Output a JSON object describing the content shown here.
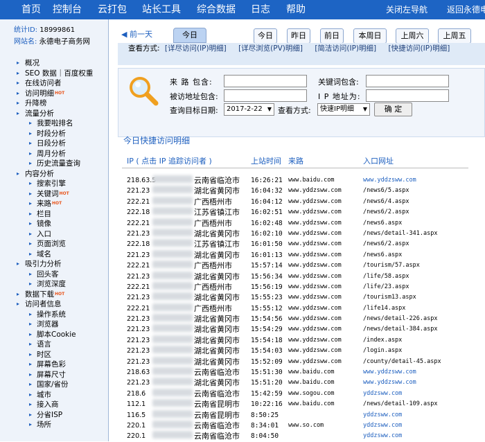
{
  "topnav": {
    "items": [
      "首页",
      "控制台",
      "云打包",
      "站长工具",
      "综合数据",
      "日志",
      "帮助"
    ],
    "close_sidebar": "关闭左导航",
    "back": "返回永德电"
  },
  "site": {
    "id_label": "统计ID:",
    "id_value": "18999861",
    "name_label": "网站名:",
    "name_value": "永德电子商务网"
  },
  "sidebar": {
    "items": [
      {
        "label": "概况",
        "level": 1,
        "hot": false
      },
      {
        "label": "SEO 数据｜百度权重",
        "level": 1,
        "hot": false
      },
      {
        "label": "在线访问者",
        "level": 1,
        "hot": false
      },
      {
        "label": "访问明细",
        "level": 1,
        "hot": true
      },
      {
        "label": "升降榜",
        "level": 1,
        "hot": false
      },
      {
        "label": "流量分析",
        "level": 1,
        "hot": false
      },
      {
        "label": "我要啦排名",
        "level": 2,
        "hot": false
      },
      {
        "label": "时段分析",
        "level": 2,
        "hot": false
      },
      {
        "label": "日段分析",
        "level": 2,
        "hot": false
      },
      {
        "label": "周月分析",
        "level": 2,
        "hot": false
      },
      {
        "label": "历史流量查询",
        "level": 2,
        "hot": false
      },
      {
        "label": "内容分析",
        "level": 1,
        "hot": false
      },
      {
        "label": "搜索引擎",
        "level": 2,
        "hot": false
      },
      {
        "label": "关键词",
        "level": 2,
        "hot": true
      },
      {
        "label": "来路",
        "level": 2,
        "hot": true
      },
      {
        "label": "栏目",
        "level": 2,
        "hot": false
      },
      {
        "label": "镜像",
        "level": 2,
        "hot": false
      },
      {
        "label": "入口",
        "level": 2,
        "hot": false
      },
      {
        "label": "页面浏览",
        "level": 2,
        "hot": false
      },
      {
        "label": "域名",
        "level": 2,
        "hot": false
      },
      {
        "label": "吸引力分析",
        "level": 1,
        "hot": false
      },
      {
        "label": "回头客",
        "level": 2,
        "hot": false
      },
      {
        "label": "浏览深度",
        "level": 2,
        "hot": false
      },
      {
        "label": "数据下载",
        "level": 1,
        "hot": true
      },
      {
        "label": "访问者信息",
        "level": 1,
        "hot": false
      },
      {
        "label": "操作系统",
        "level": 2,
        "hot": false
      },
      {
        "label": "浏览器",
        "level": 2,
        "hot": false
      },
      {
        "label": "脚本Cookie",
        "level": 2,
        "hot": false
      },
      {
        "label": "语言",
        "level": 2,
        "hot": false
      },
      {
        "label": "时区",
        "level": 2,
        "hot": false
      },
      {
        "label": "屏幕色彩",
        "level": 2,
        "hot": false
      },
      {
        "label": "屏幕尺寸",
        "level": 2,
        "hot": false
      },
      {
        "label": "国家/省份",
        "level": 2,
        "hot": false
      },
      {
        "label": "城市",
        "level": 2,
        "hot": false
      },
      {
        "label": "接入商",
        "level": 2,
        "hot": false
      },
      {
        "label": "分省ISP",
        "level": 2,
        "hot": false
      },
      {
        "label": "场所",
        "level": 2,
        "hot": false
      }
    ],
    "hot_text": "HOT"
  },
  "datebar": {
    "prev": "◀ 前一天",
    "today_tab": "今日",
    "buttons": [
      "今日",
      "昨日",
      "前日",
      "本周日",
      "上周六",
      "上周五"
    ]
  },
  "viewmode": {
    "label": "查看方式:",
    "links": [
      "[详尽访问(IP)明细]",
      "[详尽浏览(PV)明细]",
      "[简洁访问(IP)明细]",
      "[快捷访问(IP)明细]"
    ]
  },
  "filter": {
    "source_label": "来 路 包含:",
    "keyword_label": "关键词包含:",
    "page_label": "被访地址包含:",
    "ip_label": "I P 地址为:",
    "date_label": "查询目标日期:",
    "date_value": "2017-2-22",
    "view_label": "查看方式:",
    "view_value": "快速IP明细",
    "confirm": "确 定"
  },
  "list": {
    "title": "今日快捷访问明细",
    "headers": {
      "ip": "IP ( 点击 IP 追踪访问者 )",
      "time": "上站时间",
      "source": "来路",
      "entry": "入口网址"
    },
    "rows": [
      {
        "ip": "218.63.5",
        "loc": "云南省临沧市",
        "time": "16:26:21",
        "src": "www.baidu.com",
        "url": "www.yddzsww.com",
        "url_link": true
      },
      {
        "ip": "221.23",
        "loc": "湖北省黄冈市",
        "time": "16:04:32",
        "src": "www.yddzsww.com",
        "url": "/news6/5.aspx",
        "url_link": false
      },
      {
        "ip": "222.21",
        "loc": "广西梧州市",
        "time": "16:04:12",
        "src": "www.yddzsww.com",
        "url": "/news6/4.aspx",
        "url_link": false
      },
      {
        "ip": "222.18",
        "loc": "江苏省镇江市",
        "time": "16:02:51",
        "src": "www.yddzsww.com",
        "url": "/news6/2.aspx",
        "url_link": false
      },
      {
        "ip": "222.21",
        "loc": "广西梧州市",
        "time": "16:02:48",
        "src": "www.yddzsww.com",
        "url": "/news6.aspx",
        "url_link": false
      },
      {
        "ip": "221.23",
        "loc": "湖北省黄冈市",
        "time": "16:02:10",
        "src": "www.yddzsww.com",
        "url": "/news/detail-341.aspx",
        "url_link": false
      },
      {
        "ip": "222.18",
        "loc": "江苏省镇江市",
        "time": "16:01:50",
        "src": "www.yddzsww.com",
        "url": "/news6/2.aspx",
        "url_link": false
      },
      {
        "ip": "221.23",
        "loc": "湖北省黄冈市",
        "time": "16:01:13",
        "src": "www.yddzsww.com",
        "url": "/news6.aspx",
        "url_link": false
      },
      {
        "ip": "222.21",
        "loc": "广西梧州市",
        "time": "15:57:14",
        "src": "www.yddzsww.com",
        "url": "/tourism/57.aspx",
        "url_link": false
      },
      {
        "ip": "221.23",
        "loc": "湖北省黄冈市",
        "time": "15:56:34",
        "src": "www.yddzsww.com",
        "url": "/life/58.aspx",
        "url_link": false
      },
      {
        "ip": "222.21",
        "loc": "广西梧州市",
        "time": "15:56:19",
        "src": "www.yddzsww.com",
        "url": "/life/23.aspx",
        "url_link": false
      },
      {
        "ip": "221.23",
        "loc": "湖北省黄冈市",
        "time": "15:55:23",
        "src": "www.yddzsww.com",
        "url": "/tourism13.aspx",
        "url_link": false
      },
      {
        "ip": "222.21",
        "loc": "广西梧州市",
        "time": "15:55:12",
        "src": "www.yddzsww.com",
        "url": "/life14.aspx",
        "url_link": false
      },
      {
        "ip": "221.23",
        "loc": "湖北省黄冈市",
        "time": "15:54:56",
        "src": "www.yddzsww.com",
        "url": "/news/detail-226.aspx",
        "url_link": false
      },
      {
        "ip": "221.23",
        "loc": "湖北省黄冈市",
        "time": "15:54:29",
        "src": "www.yddzsww.com",
        "url": "/news/detail-384.aspx",
        "url_link": false
      },
      {
        "ip": "221.23",
        "loc": "湖北省黄冈市",
        "time": "15:54:18",
        "src": "www.yddzsww.com",
        "url": "/index.aspx",
        "url_link": false
      },
      {
        "ip": "221.23",
        "loc": "湖北省黄冈市",
        "time": "15:54:03",
        "src": "www.yddzsww.com",
        "url": "/login.aspx",
        "url_link": false
      },
      {
        "ip": "221.23",
        "loc": "湖北省黄冈市",
        "time": "15:52:09",
        "src": "www.yddzsww.com",
        "url": "/county/detail-45.aspx",
        "url_link": false
      },
      {
        "ip": "218.63",
        "loc": "云南省临沧市",
        "time": "15:51:30",
        "src": "www.baidu.com",
        "url": "www.yddzsww.com",
        "url_link": true
      },
      {
        "ip": "221.23",
        "loc": "湖北省黄冈市",
        "time": "15:51:20",
        "src": "www.baidu.com",
        "url": "www.yddzsww.com",
        "url_link": true
      },
      {
        "ip": "218.6",
        "loc": "云南省临沧市",
        "time": "15:42:59",
        "src": "www.sogou.com",
        "url": "yddzsww.com",
        "url_link": true
      },
      {
        "ip": "112.1",
        "loc": "云南省昆明市",
        "time": "10:22:16",
        "src": "www.baidu.com",
        "url": "/news/detail-109.aspx",
        "url_link": false
      },
      {
        "ip": "116.5",
        "loc": "云南省昆明市",
        "time": "8:50:25",
        "src": "",
        "url": "yddzsww.com",
        "url_link": true
      },
      {
        "ip": "220.1",
        "loc": "云南省临沧市",
        "time": "8:34:01",
        "src": "www.so.com",
        "url": "yddzsww.com",
        "url_link": true
      },
      {
        "ip": "220.1",
        "loc": "云南省临沧市",
        "time": "8:04:50",
        "src": "",
        "url": "yddzsww.com",
        "url_link": true
      }
    ]
  },
  "colors": {
    "nav_bg": "#1d64c4",
    "link": "#1d5fbf",
    "hot": "#e8541a",
    "panel_bg": "#dfeaf7"
  }
}
